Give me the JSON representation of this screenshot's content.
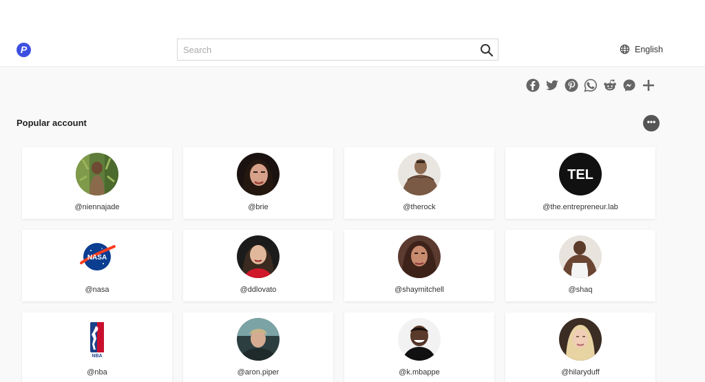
{
  "header": {
    "logo_letter": "P",
    "search_placeholder": "Search",
    "language": "English"
  },
  "share": [
    "facebook-icon",
    "twitter-icon",
    "pinterest-icon",
    "whatsapp-icon",
    "reddit-icon",
    "messenger-icon",
    "plus-icon"
  ],
  "section": {
    "title": "Popular account",
    "more": "•••"
  },
  "accounts": [
    {
      "handle": "@niennajade"
    },
    {
      "handle": "@brie"
    },
    {
      "handle": "@therock"
    },
    {
      "handle": "@the.entrepreneur.lab",
      "logo_text": "TEL"
    },
    {
      "handle": "@nasa",
      "logo_text": "NASA"
    },
    {
      "handle": "@ddlovato"
    },
    {
      "handle": "@shaymitchell"
    },
    {
      "handle": "@shaq"
    },
    {
      "handle": "@nba",
      "logo_text": "NBA"
    },
    {
      "handle": "@aron.piper"
    },
    {
      "handle": "@k.mbappe"
    },
    {
      "handle": "@hilaryduff"
    }
  ]
}
